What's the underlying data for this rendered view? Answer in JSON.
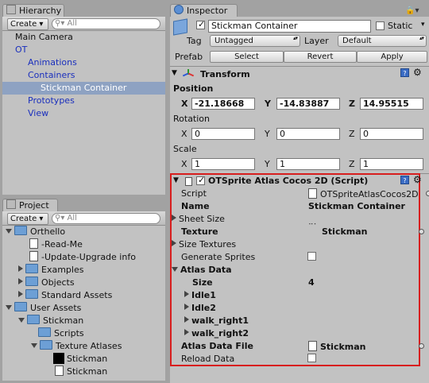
{
  "hierarchy": {
    "tab": "Hierarchy",
    "create": "Create",
    "search_placeholder": "All",
    "items": [
      "Main Camera",
      "OT",
      "Animations",
      "Containers",
      "Stickman Container",
      "Prototypes",
      "View"
    ]
  },
  "project": {
    "tab": "Project",
    "create": "Create",
    "search_placeholder": "All",
    "items": [
      "Orthello",
      "-Read-Me",
      "-Update-Upgrade info",
      "Examples",
      "Objects",
      "Standard Assets",
      "User Assets",
      "Stickman",
      "Scripts",
      "Texture Atlases",
      "Stickman",
      "Stickman"
    ]
  },
  "inspector": {
    "tab": "Inspector",
    "object_name": "Stickman Container",
    "static_label": "Static",
    "tag_label": "Tag",
    "tag_value": "Untagged",
    "layer_label": "Layer",
    "layer_value": "Default",
    "prefab_label": "Prefab",
    "prefab_select": "Select",
    "prefab_revert": "Revert",
    "prefab_apply": "Apply",
    "transform": {
      "title": "Transform",
      "position_label": "Position",
      "x_label": "X",
      "y_label": "Y",
      "z_label": "Z",
      "position": [
        "-21.18668",
        "-14.83887",
        "14.95515"
      ],
      "rotation_label": "Rotation",
      "rotation": [
        "0",
        "0",
        "0"
      ],
      "scale_label": "Scale",
      "scale": [
        "1",
        "1",
        "1"
      ]
    },
    "script": {
      "title": "OTSprite Atlas Cocos 2D (Script)",
      "script_label": "Script",
      "script_value": "OTSpriteAtlasCocos2D",
      "name_label": "Name",
      "name_value": "Stickman Container",
      "sheet_size_label": "Sheet Size",
      "texture_label": "Texture",
      "texture_value": "Stickman",
      "size_textures_label": "Size Textures",
      "generate_sprites_label": "Generate Sprites",
      "atlas_data_label": "Atlas Data",
      "size_label": "Size",
      "size_value": "4",
      "atlas_items": [
        "Idle1",
        "Idle2",
        "walk_right1",
        "walk_right2"
      ],
      "atlas_data_file_label": "Atlas Data File",
      "atlas_data_file_value": "Stickman",
      "reload_data_label": "Reload Data"
    }
  },
  "colors": {
    "highlight_box": "#d81e1e",
    "selection": "#8ea2c2",
    "link_blue": "#1a2fbd"
  }
}
